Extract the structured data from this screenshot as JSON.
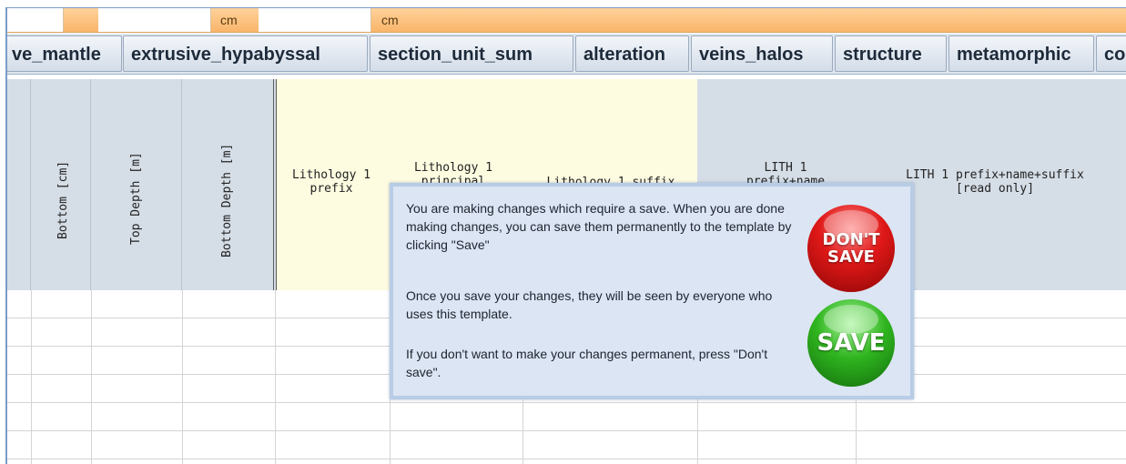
{
  "unit_row": {
    "cells": [
      "cm",
      "cm"
    ]
  },
  "tabs": [
    "ve_mantle",
    "extrusive_hypabyssal",
    "section_unit_sum",
    "alteration",
    "veins_halos",
    "structure",
    "metamorphic",
    "co"
  ],
  "columns": {
    "bottom_cm": "Bottom [cm]",
    "top_depth_m": "Top Depth [m]",
    "bottom_depth_m": "Bottom Depth [m]",
    "lith1_prefix": "Lithology 1\nprefix",
    "lith1_principal": "Lithology 1\nprincipal",
    "lith1_suffix": "Lithology 1 suffix",
    "lith1_prefix_name": "LITH 1\nprefix+name",
    "lith1_full": "LITH 1 prefix+name+suffix\n[read only]"
  },
  "dialog": {
    "paragraph1": "You are making changes which require a save. When you are done making changes, you can save them permanently to the template by clicking \"Save\"",
    "paragraph2": "Once you save your changes, they will be seen by everyone who uses this template.",
    "paragraph3": "If you don't want to make your changes permanent, press \"Don't save\".",
    "dont_save_label": "DON'T SAVE",
    "save_label": "SAVE",
    "dont_save_color": "#e01818",
    "save_color": "#2fb51f"
  }
}
